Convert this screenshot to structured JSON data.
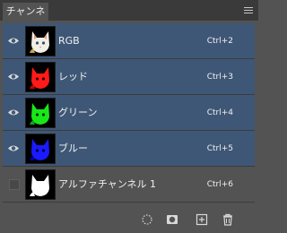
{
  "panel": {
    "tab_title": "チャンネル"
  },
  "channels": [
    {
      "name": "RGB",
      "shortcut": "Ctrl+2",
      "visible": true,
      "selected": true,
      "thumb": "composite"
    },
    {
      "name": "レッド",
      "shortcut": "Ctrl+3",
      "visible": true,
      "selected": true,
      "thumb": "red"
    },
    {
      "name": "グリーン",
      "shortcut": "Ctrl+4",
      "visible": true,
      "selected": true,
      "thumb": "green"
    },
    {
      "name": "ブルー",
      "shortcut": "Ctrl+5",
      "visible": true,
      "selected": true,
      "thumb": "blue"
    },
    {
      "name": "アルファチャンネル 1",
      "shortcut": "Ctrl+6",
      "visible": false,
      "selected": false,
      "thumb": "alpha"
    }
  ],
  "footer_icons": [
    "load-selection-icon",
    "save-selection-icon",
    "new-channel-icon",
    "trash-icon"
  ],
  "colors": {
    "selected_row": "#3f5776",
    "panel_bg": "#535353"
  }
}
